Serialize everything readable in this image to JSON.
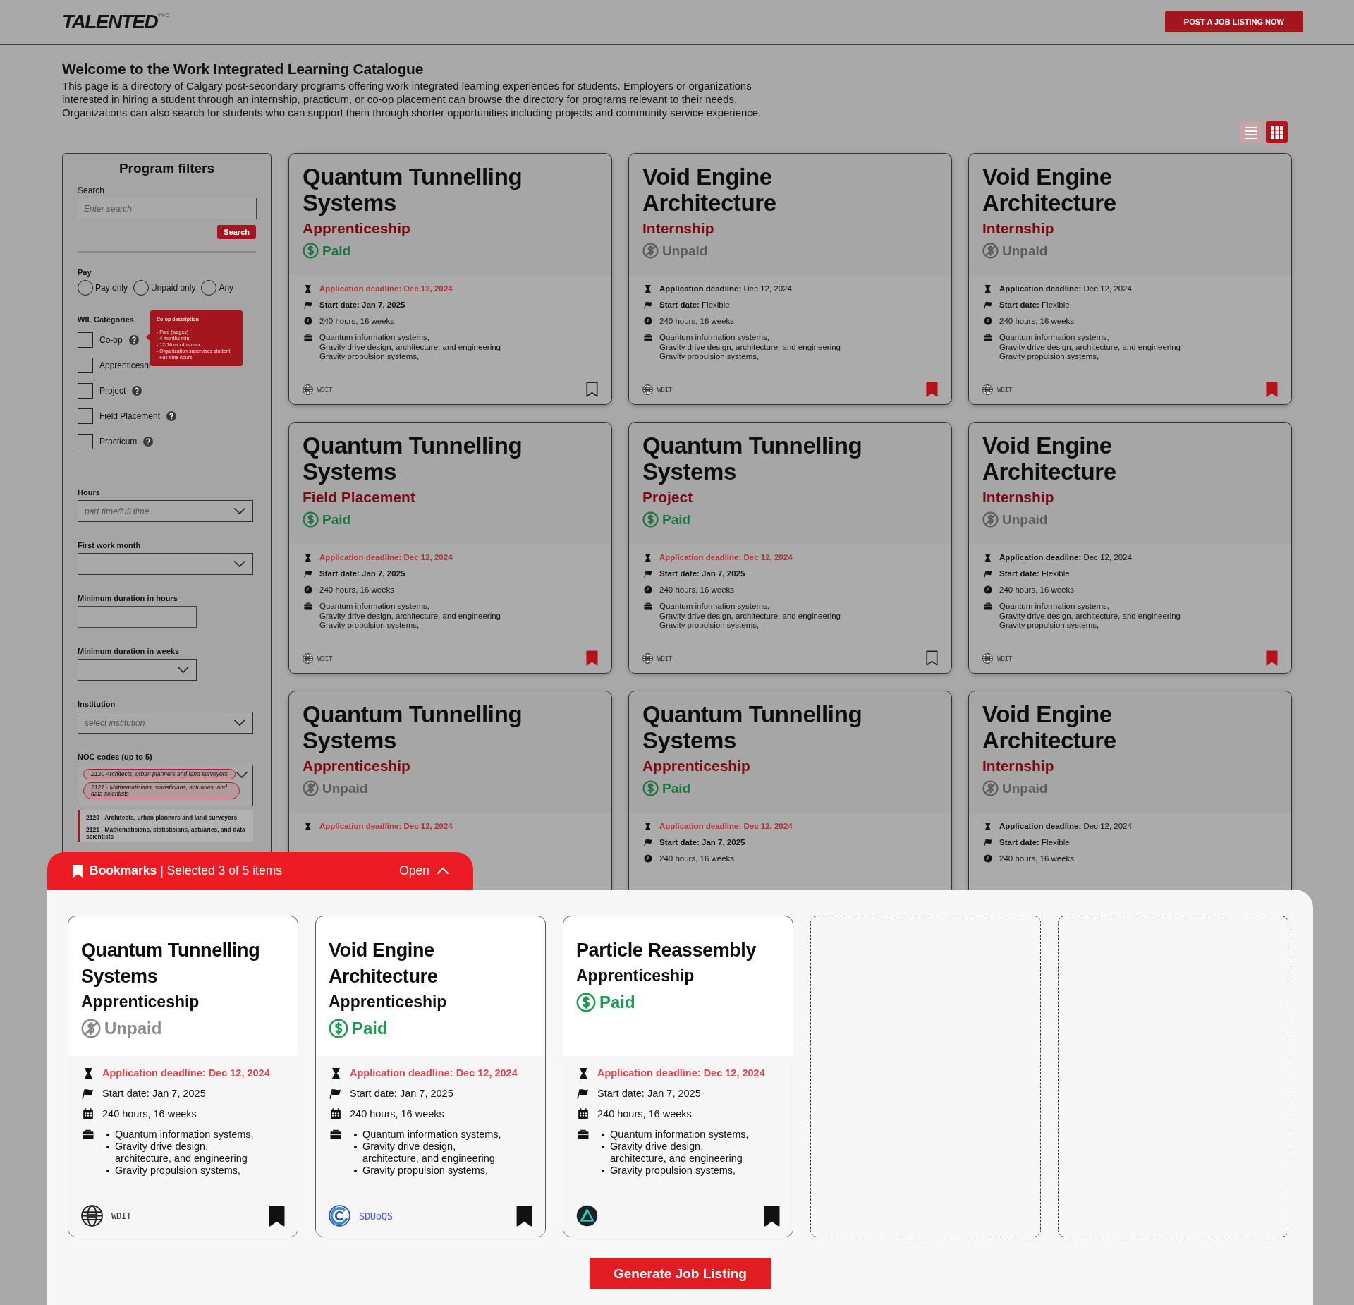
{
  "header": {
    "logo": "TALENTED",
    "logo_suffix": "YYC",
    "post_button": "POST A JOB LISTING NOW"
  },
  "intro": {
    "title": "Welcome to the Work Integrated Learning Catalogue",
    "text": "This page is a directory of Calgary post-secondary programs offering work integrated learning experiences for students. Employers or organizations interested in hiring a student through an internship, practicum, or co-op placement can browse the directory for programs relevant to their needs. Organizations can also search for students who can support them through shorter opportunities including projects and community service experience."
  },
  "view_toggle": [
    {
      "kind": "list",
      "selected": false
    },
    {
      "kind": "grid",
      "selected": true
    }
  ],
  "filters": {
    "title": "Program filters",
    "search": {
      "label": "Search",
      "placeholder": "Enter search",
      "button": "Search"
    },
    "pay": {
      "label": "Pay",
      "options": [
        {
          "label": "Pay only",
          "selected": false
        },
        {
          "label": "Unpaid only",
          "selected": false
        },
        {
          "label": "Any",
          "selected": false
        }
      ]
    },
    "categories": {
      "label": "WIL Categories",
      "items": [
        {
          "label": "Co-op",
          "checked": false,
          "help": true
        },
        {
          "label": "Apprenticeshi",
          "checked": false,
          "help": false
        },
        {
          "label": "Project",
          "checked": false,
          "help": true
        },
        {
          "label": "Field Placement",
          "checked": false,
          "help": true
        },
        {
          "label": "Practicum",
          "checked": false,
          "help": true
        }
      ]
    },
    "tooltip": {
      "title": "Co-op description",
      "lines": [
        "- Paid (wages)",
        "- 4 months min.",
        "- 12-16 months max",
        "- Organization supervises student",
        "- Full-time hours"
      ]
    },
    "fields": [
      {
        "kind": "select",
        "label": "Hours",
        "placeholder": "part time/full time"
      },
      {
        "kind": "select",
        "label": "First work month"
      },
      {
        "kind": "short-input",
        "label": "Minimum duration in hours"
      },
      {
        "kind": "short-select",
        "label": "Minimum duration in weeks"
      },
      {
        "kind": "select",
        "label": "Institution",
        "placeholder": "select institution"
      }
    ],
    "noc": {
      "label": "NOC codes (up to 5)",
      "chips": [
        "2120 Architects, urban planners and land surveyors",
        "2121 - Mathematicians, statisticians, actuaries, and data scientists"
      ],
      "expanded": true,
      "options": [
        "2120 - Architects, urban planners and land surveyors",
        "2121 - Mathematicians, statisticians, actuaries, and data scientists"
      ]
    }
  },
  "programs": [
    {
      "title": "Quantum Tunnelling Systems",
      "category": "Apprenticeship",
      "pay": "Paid",
      "paid": true,
      "deadline": "Application deadline: Dec 12, 2024",
      "urgent": true,
      "start": "Start date: Jan 7, 2025",
      "start_fixed": true,
      "hours": "240 hours, 16 weeks",
      "skills": [
        "Quantum information systems,",
        "Gravity drive design, architecture, and engineering",
        "Gravity propulsion systems,"
      ],
      "institution": {
        "kind": "globe",
        "name": "WDIT"
      },
      "bookmarked": false
    },
    {
      "title": "Void Engine Architecture",
      "category": "Internship",
      "pay": "Unpaid",
      "paid": false,
      "deadline": "**Application deadline:** Dec 12, 2024",
      "urgent": false,
      "start": "**Start date:** Flexible",
      "start_fixed": false,
      "hours": "240 hours, 16 weeks",
      "skills": [
        "Quantum information systems,",
        "Gravity drive design, architecture, and engineering",
        "Gravity propulsion systems,"
      ],
      "institution": {
        "kind": "globe",
        "name": "WDIT"
      },
      "bookmarked": true
    },
    {
      "title": "Void Engine Architecture",
      "category": "Internship",
      "pay": "Unpaid",
      "paid": false,
      "deadline": "**Application deadline:** Dec 12, 2024",
      "urgent": false,
      "start": "**Start date:** Flexible",
      "start_fixed": false,
      "hours": "240 hours, 16 weeks",
      "skills": [
        "Quantum information systems,",
        "Gravity drive design, architecture, and engineering",
        "Gravity propulsion systems,"
      ],
      "institution": {
        "kind": "globe",
        "name": "WDIT"
      },
      "bookmarked": true
    },
    {
      "title": "Quantum Tunnelling Systems",
      "category": "Field Placement",
      "pay": "Paid",
      "paid": true,
      "deadline": "Application deadline: Dec 12, 2024",
      "urgent": true,
      "start": "Start date: Jan 7, 2025",
      "start_fixed": true,
      "hours": "240 hours, 16 weeks",
      "skills": [
        "Quantum information systems,",
        "Gravity drive design, architecture, and engineering",
        "Gravity propulsion systems,"
      ],
      "institution": {
        "kind": "globe",
        "name": "WDIT"
      },
      "bookmarked": true
    },
    {
      "title": "Quantum Tunnelling Systems",
      "category": "Project",
      "pay": "Paid",
      "paid": true,
      "deadline": "Application deadline: Dec 12, 2024",
      "urgent": true,
      "start": "Start date: Jan 7, 2025",
      "start_fixed": true,
      "hours": "240 hours, 16 weeks",
      "skills": [
        "Quantum information systems,",
        "Gravity drive design, architecture, and engineering",
        "Gravity propulsion systems,"
      ],
      "institution": {
        "kind": "globe",
        "name": "WDIT"
      },
      "bookmarked": false
    },
    {
      "title": "Void Engine Architecture",
      "category": "Internship",
      "pay": "Unpaid",
      "paid": false,
      "deadline": "**Application deadline:** Dec 12, 2024",
      "urgent": false,
      "start": "**Start date:** Flexible",
      "start_fixed": false,
      "hours": "240 hours, 16 weeks",
      "skills": [
        "Quantum information systems,",
        "Gravity drive design, architecture, and engineering",
        "Gravity propulsion systems,"
      ],
      "institution": {
        "kind": "globe",
        "name": "WDIT"
      },
      "bookmarked": true
    },
    {
      "title": "Quantum Tunnelling Systems",
      "category": "Apprenticeship",
      "pay": "Unpaid",
      "paid": false,
      "deadline": "Application deadline: Dec 12, 2024",
      "urgent": true
    },
    {
      "title": "Quantum Tunnelling Systems",
      "category": "Apprenticeship",
      "pay": "Paid",
      "paid": true,
      "deadline": "Application deadline: Dec 12, 2024",
      "urgent": true,
      "start": "Start date: Jan 7, 2025",
      "start_fixed": true,
      "hours": "240 hours, 16 weeks"
    },
    {
      "title": "Void Engine Architecture",
      "category": "Internship",
      "pay": "Unpaid",
      "paid": false,
      "deadline": "**Application deadline:** Dec 12, 2024",
      "urgent": false,
      "start": "**Start date:** Flexible",
      "start_fixed": false,
      "hours": "240 hours, 16 weeks"
    }
  ],
  "bookmarks": {
    "header": "**Bookmarks** | Selected 3 of 5 items",
    "toggle": "Open",
    "slots": [
      {
        "kind": "program",
        "title": "Quantum Tunnelling Systems",
        "category": "Apprenticeship",
        "pay": "Unpaid",
        "paid": false,
        "deadline": "Application deadline: Dec 12, 2024",
        "urgent": true,
        "start": "Start date: Jan 7, 2025",
        "hours": "240 hours, 16 weeks",
        "skills": [
          "Quantum information systems,",
          "Gravity drive design, architecture, and engineering",
          "Gravity propulsion systems,"
        ],
        "institution": {
          "kind": "globe",
          "name": "WDIT"
        },
        "bookmarked": true
      },
      {
        "kind": "program",
        "title": "Void Engine Architecture",
        "category": "Apprenticeship",
        "pay": "Paid",
        "paid": true,
        "deadline": "Application deadline: Dec 12, 2024",
        "urgent": true,
        "start": "Start date: Jan 7, 2025",
        "hours": "240 hours, 16 weeks",
        "skills": [
          "Quantum information systems,",
          "Gravity drive design, architecture, and engineering",
          "Gravity propulsion systems,"
        ],
        "institution": {
          "kind": "swirl",
          "name": "SDUoQS"
        },
        "bookmarked": true
      },
      {
        "kind": "program",
        "title": "Particle Reassembly",
        "category": "Apprenticeship",
        "pay": "Paid",
        "paid": true,
        "deadline": "Application deadline: Dec 12, 2024",
        "urgent": true,
        "start": "Start date: Jan 7, 2025",
        "hours": "240 hours, 16 weeks",
        "skills": [
          "Quantum information systems,",
          "Gravity drive design, architecture, and engineering",
          "Gravity propulsion systems,"
        ],
        "institution": {
          "kind": "triangle"
        },
        "bookmarked": true
      },
      {
        "kind": "empty"
      },
      {
        "kind": "empty"
      }
    ],
    "generate_button": "Generate Job Listing"
  }
}
